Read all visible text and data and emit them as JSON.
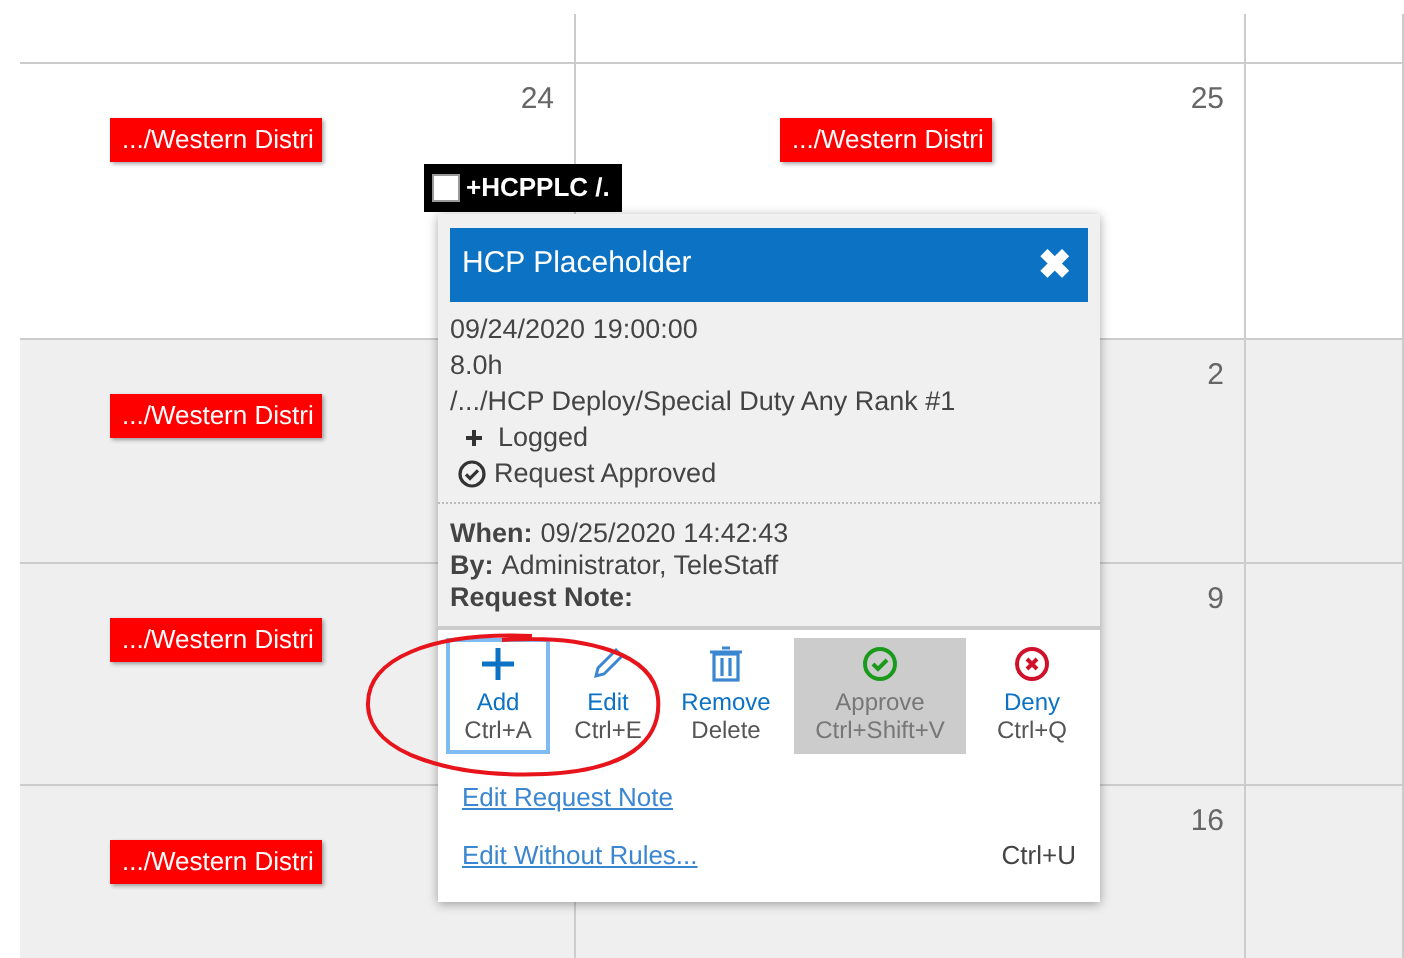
{
  "calendar": {
    "weeks": [
      {
        "cells": [
          {
            "day": "24",
            "events": [
              ".../Western Distri"
            ]
          },
          {
            "day": "25",
            "events": [
              ".../Western Distri"
            ]
          },
          {}
        ],
        "shade": false
      },
      {
        "cells": [
          {
            "events": [
              ".../Western Distri"
            ]
          },
          {
            "day": "2"
          },
          {}
        ],
        "shade": true
      },
      {
        "cells": [
          {
            "events": [
              ".../Western Distri"
            ]
          },
          {
            "day": "9"
          },
          {}
        ],
        "shade": true
      },
      {
        "cells": [
          {
            "events": [
              ".../Western Distri"
            ]
          },
          {
            "day": "16"
          },
          {}
        ],
        "shade": true
      }
    ]
  },
  "hover_label": {
    "text": "+HCPPLC /.",
    "checked": false
  },
  "popup": {
    "title": "HCP Placeholder",
    "close": "✖",
    "details": [
      "09/24/2020 19:00:00",
      "8.0h",
      "/.../HCP Deploy/Special Duty Any Rank #1"
    ],
    "statuses": [
      {
        "kind": "plus",
        "text": "Logged"
      },
      {
        "kind": "check",
        "text": "Request Approved"
      }
    ],
    "info": [
      {
        "label": "When:",
        "value": "09/25/2020 14:42:43"
      },
      {
        "label": "By:",
        "value": "Administrator, TeleStaff"
      },
      {
        "label": "Request Note:"
      }
    ],
    "actions": [
      {
        "kind": "plus",
        "label": "Add",
        "shortcut": "Ctrl+A",
        "focused": true,
        "disabled": false
      },
      {
        "kind": "pencil",
        "label": "Edit",
        "shortcut": "Ctrl+E",
        "focused": false,
        "disabled": false
      },
      {
        "kind": "trash",
        "label": "Remove",
        "shortcut": "Delete",
        "focused": false,
        "disabled": false
      },
      {
        "kind": "approve",
        "label": "Approve",
        "shortcut": "Ctrl+Shift+V",
        "focused": false,
        "disabled": true
      },
      {
        "kind": "deny",
        "label": "Deny",
        "shortcut": "Ctrl+Q",
        "focused": false,
        "disabled": false
      }
    ],
    "links": [
      {
        "text": "Edit Request Note"
      },
      {
        "text": "Edit Without Rules...",
        "shortcut": "Ctrl+U"
      }
    ]
  },
  "annotation": {
    "kind": "circle"
  }
}
